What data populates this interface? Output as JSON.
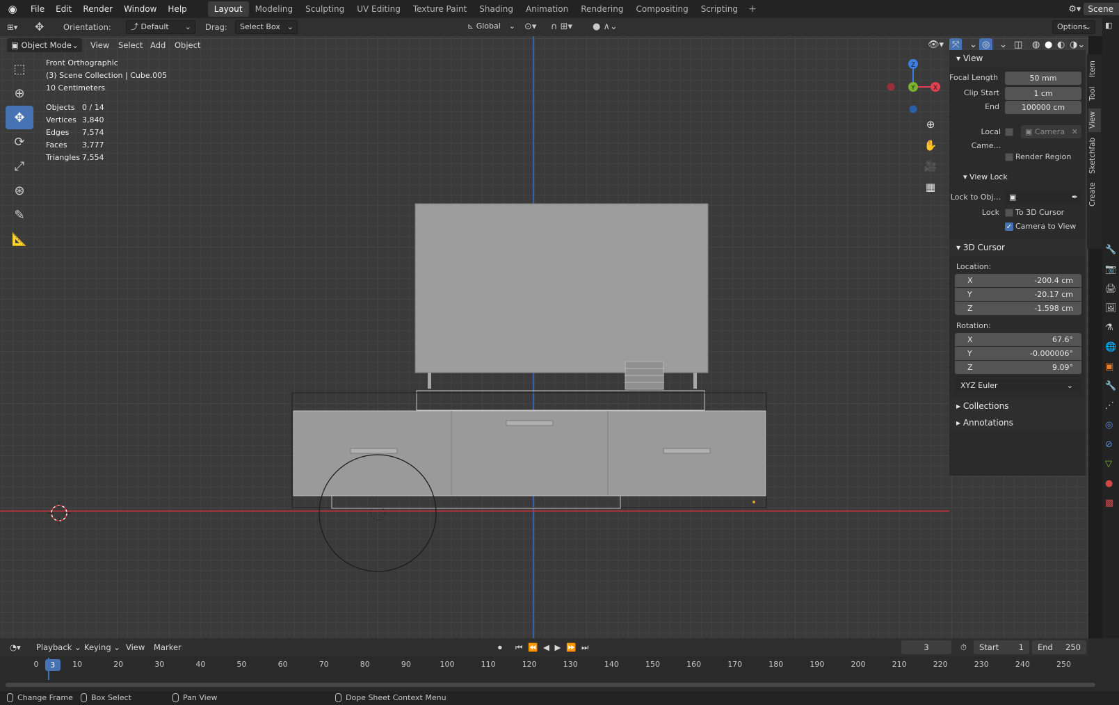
{
  "menubar": {
    "logo": "blender-logo",
    "items": [
      "File",
      "Edit",
      "Render",
      "Window",
      "Help"
    ],
    "workspaces": [
      "Layout",
      "Modeling",
      "Sculpting",
      "UV Editing",
      "Texture Paint",
      "Shading",
      "Animation",
      "Rendering",
      "Compositing",
      "Scripting"
    ],
    "active_workspace": "Layout",
    "add_workspace": "+",
    "scene": "Scene"
  },
  "toolbar": {
    "orientation_label": "Orientation:",
    "orientation_value": "Default",
    "drag_label": "Drag:",
    "drag_value": "Select Box",
    "transform_orientation": "Global",
    "options": "Options"
  },
  "viewport": {
    "mode": "Object Mode",
    "menus": [
      "View",
      "Select",
      "Add",
      "Object"
    ],
    "info_title": "Front Orthographic",
    "info_collection": "(3) Scene Collection | Cube.005",
    "info_scale": "10 Centimeters",
    "stats": [
      {
        "key": "Objects",
        "value": "0 / 14"
      },
      {
        "key": "Vertices",
        "value": "3,840"
      },
      {
        "key": "Edges",
        "value": "7,574"
      },
      {
        "key": "Faces",
        "value": "3,777"
      },
      {
        "key": "Triangles",
        "value": "7,554"
      }
    ],
    "gizmo": {
      "z": "Z",
      "y": "Y",
      "x": "X"
    },
    "colors": {
      "x_axis": "#c8303a",
      "y_axis": "#2f6fd0",
      "active_tool": "#4772b3"
    }
  },
  "npanel": {
    "tabs": [
      "Item",
      "Tool",
      "View",
      "Sketchfab",
      "Create"
    ],
    "active_tab": "View",
    "view_section": "View",
    "focal_length_label": "Focal Length",
    "focal_length": "50 mm",
    "clip_start_label": "Clip Start",
    "clip_start": "1 cm",
    "clip_end_label": "End",
    "clip_end": "100000 cm",
    "local_camera_label": "Local Came...",
    "local_camera_value": "Camera",
    "render_region": "Render Region",
    "view_lock_section": "View Lock",
    "lock_to_obj_label": "Lock to Obj...",
    "lock_label": "Lock",
    "to_3d_cursor": "To 3D Cursor",
    "camera_to_view": "Camera to View",
    "cursor_section": "3D Cursor",
    "location_label": "Location:",
    "location": [
      {
        "axis": "X",
        "value": "-200.4 cm"
      },
      {
        "axis": "Y",
        "value": "-20.17 cm"
      },
      {
        "axis": "Z",
        "value": "-1.598 cm"
      }
    ],
    "rotation_label": "Rotation:",
    "rotation": [
      {
        "axis": "X",
        "value": "67.6°"
      },
      {
        "axis": "Y",
        "value": "-0.000006°"
      },
      {
        "axis": "Z",
        "value": "9.09°"
      }
    ],
    "rotation_mode": "XYZ Euler",
    "collections": "Collections",
    "annotations": "Annotations"
  },
  "timeline": {
    "menus": [
      "Playback",
      "Keying",
      "View",
      "Marker"
    ],
    "current_frame": "3",
    "start_label": "Start",
    "start": "1",
    "end_label": "End",
    "end": "250",
    "ruler": [
      "0",
      "10",
      "20",
      "30",
      "40",
      "50",
      "60",
      "70",
      "80",
      "90",
      "100",
      "110",
      "120",
      "130",
      "140",
      "150",
      "160",
      "170",
      "180",
      "190",
      "200",
      "210",
      "220",
      "230",
      "240",
      "250"
    ]
  },
  "statusbar": {
    "items": [
      "Change Frame",
      "Box Select",
      "Pan View",
      "Dope Sheet Context Menu"
    ]
  }
}
